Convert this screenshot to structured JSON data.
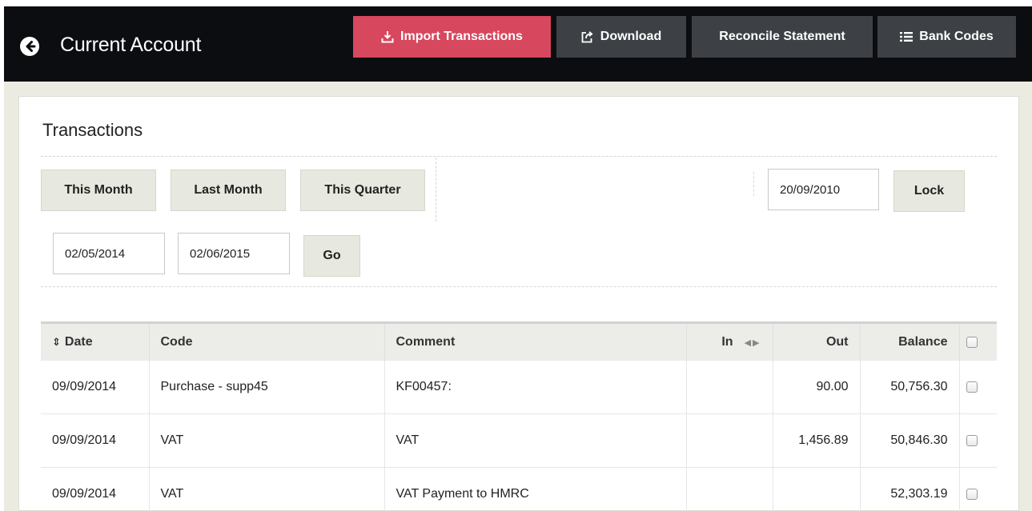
{
  "header": {
    "title": "Current Account",
    "buttons": {
      "import": "Import Transactions",
      "download": "Download",
      "reconcile": "Reconcile Statement",
      "bank_codes": "Bank Codes"
    }
  },
  "transactions": {
    "title": "Transactions",
    "quick_filters": {
      "this_month": "This Month",
      "last_month": "Last Month",
      "this_quarter": "This Quarter"
    },
    "lock_date": "20/09/2010",
    "lock_label": "Lock",
    "from_date": "02/05/2014",
    "to_date": "02/06/2015",
    "go_label": "Go"
  },
  "table": {
    "columns": {
      "date": "Date",
      "code": "Code",
      "comment": "Comment",
      "in": "In",
      "out": "Out",
      "balance": "Balance"
    },
    "rows": [
      {
        "date": "09/09/2014",
        "code": "Purchase - supp45",
        "comment": "KF00457:",
        "in": "",
        "out": "90.00",
        "balance": "50,756.30"
      },
      {
        "date": "09/09/2014",
        "code": "VAT",
        "comment": "VAT",
        "in": "",
        "out": "1,456.89",
        "balance": "50,846.30"
      },
      {
        "date": "09/09/2014",
        "code": "VAT",
        "comment": "VAT Payment to HMRC",
        "in": "",
        "out": "",
        "balance": "52,303.19"
      }
    ]
  },
  "colors": {
    "topbar": "#0c0d10",
    "accent": "#d7475d",
    "dark_button": "#3d4146",
    "frame": "#ecebe2"
  },
  "icons": {
    "back": "arrow-circle-left-icon",
    "import": "import-tray-icon",
    "download": "share-out-icon",
    "bank_codes": "list-icon",
    "sort": "sort-icon",
    "resize": "column-resize-icon"
  }
}
